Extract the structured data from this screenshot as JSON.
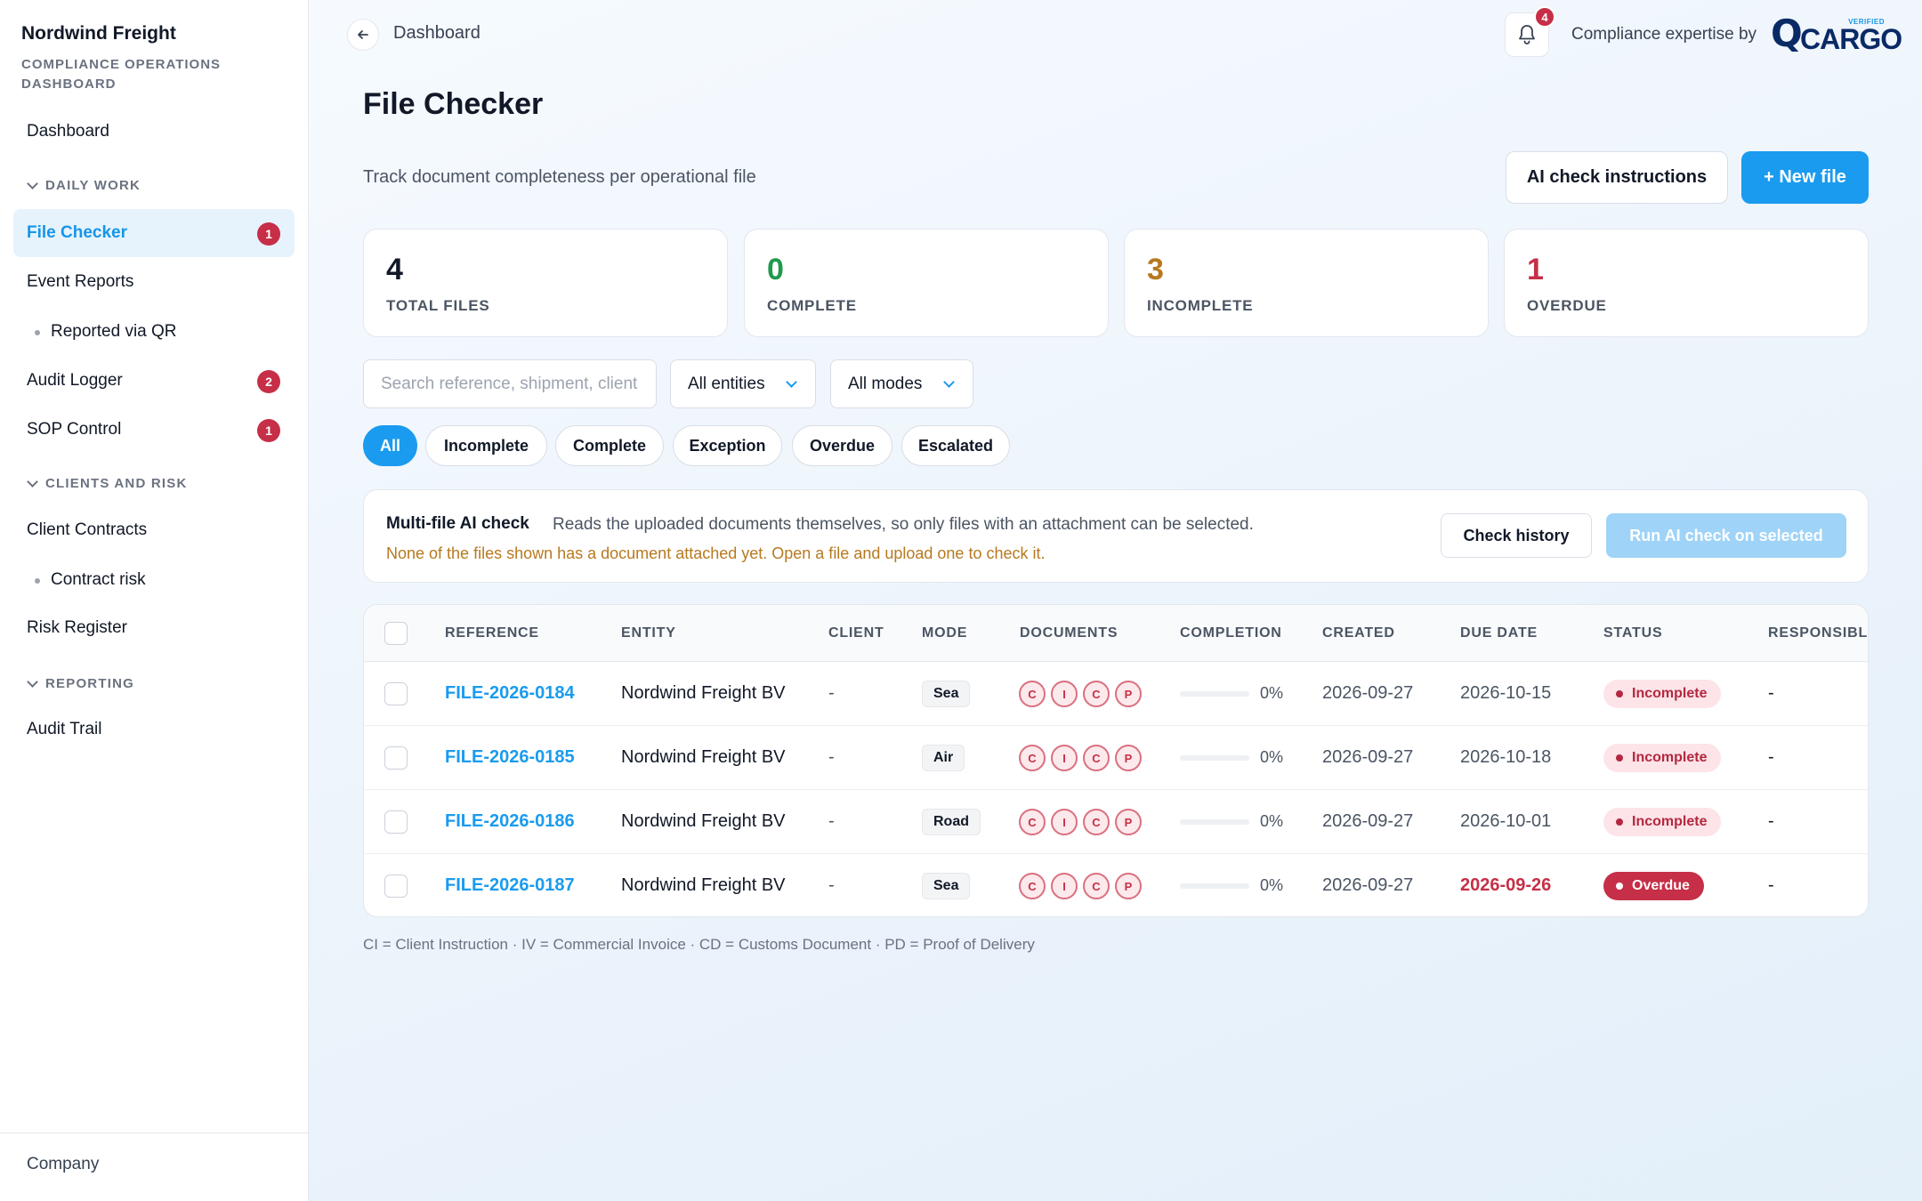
{
  "sidebar": {
    "brand": "Nordwind Freight",
    "subtitle": "COMPLIANCE OPERATIONS DASHBOARD",
    "dashboard": "Dashboard",
    "sections": {
      "daily_work": "DAILY WORK",
      "clients_risk": "CLIENTS AND RISK",
      "reporting": "REPORTING"
    },
    "items": {
      "file_checker": {
        "label": "File Checker",
        "badge": "1"
      },
      "event_reports": {
        "label": "Event Reports"
      },
      "reported_qr": {
        "label": "Reported via QR"
      },
      "audit_logger": {
        "label": "Audit Logger",
        "badge": "2"
      },
      "sop_control": {
        "label": "SOP Control",
        "badge": "1"
      },
      "client_contracts": {
        "label": "Client Contracts"
      },
      "contract_risk": {
        "label": "Contract risk"
      },
      "risk_register": {
        "label": "Risk Register"
      },
      "audit_trail": {
        "label": "Audit Trail"
      }
    },
    "footer": "Company"
  },
  "topbar": {
    "breadcrumb": "Dashboard",
    "notifications": "4",
    "expertise": "Compliance expertise by",
    "logo_q": "Q",
    "logo_text": "CARGO",
    "logo_verified": "VERIFIED"
  },
  "header": {
    "title": "File Checker",
    "subtitle": "Track document completeness per operational file",
    "ai_instructions": "AI check instructions",
    "new_file": "+ New file"
  },
  "stats": [
    {
      "value": "4",
      "label": "TOTAL FILES",
      "color": "#111827"
    },
    {
      "value": "0",
      "label": "COMPLETE",
      "color": "#1f9a4e"
    },
    {
      "value": "3",
      "label": "INCOMPLETE",
      "color": "#b7791f"
    },
    {
      "value": "1",
      "label": "OVERDUE",
      "color": "#c62f47"
    }
  ],
  "filters": {
    "search_placeholder": "Search reference, shipment, client",
    "entities": "All entities",
    "modes": "All modes",
    "pills": [
      "All",
      "Incomplete",
      "Complete",
      "Exception",
      "Overdue",
      "Escalated"
    ],
    "active_pill": "All"
  },
  "ai_panel": {
    "title": "Multi-file AI check",
    "description": "Reads the uploaded documents themselves, so only files with an attachment can be selected.",
    "warning": "None of the files shown has a document attached yet. Open a file and upload one to check it.",
    "history": "Check history",
    "run": "Run AI check on selected"
  },
  "table": {
    "columns": [
      "REFERENCE",
      "ENTITY",
      "CLIENT",
      "MODE",
      "DOCUMENTS",
      "COMPLETION",
      "CREATED",
      "DUE DATE",
      "STATUS",
      "RESPONSIBLE"
    ],
    "rows": [
      {
        "reference": "FILE-2026-0184",
        "entity": "Nordwind Freight BV",
        "client": "-",
        "mode": "Sea",
        "docs": [
          "C",
          "I",
          "C",
          "P"
        ],
        "completion": "0%",
        "completion_value": 0,
        "created": "2026-09-27",
        "due": "2026-10-15",
        "status": "Incomplete",
        "responsible": "-"
      },
      {
        "reference": "FILE-2026-0185",
        "entity": "Nordwind Freight BV",
        "client": "-",
        "mode": "Air",
        "docs": [
          "C",
          "I",
          "C",
          "P"
        ],
        "completion": "0%",
        "completion_value": 0,
        "created": "2026-09-27",
        "due": "2026-10-18",
        "status": "Incomplete",
        "responsible": "-"
      },
      {
        "reference": "FILE-2026-0186",
        "entity": "Nordwind Freight BV",
        "client": "-",
        "mode": "Road",
        "docs": [
          "C",
          "I",
          "C",
          "P"
        ],
        "completion": "0%",
        "completion_value": 0,
        "created": "2026-09-27",
        "due": "2026-10-01",
        "status": "Incomplete",
        "responsible": "-"
      },
      {
        "reference": "FILE-2026-0187",
        "entity": "Nordwind Freight BV",
        "client": "-",
        "mode": "Sea",
        "docs": [
          "C",
          "I",
          "C",
          "P"
        ],
        "completion": "0%",
        "completion_value": 0,
        "created": "2026-09-27",
        "due": "2026-09-26",
        "status": "Overdue",
        "responsible": "-"
      }
    ]
  },
  "legend": "CI = Client Instruction · IV = Commercial Invoice · CD = Customs Document · PD = Proof of Delivery"
}
